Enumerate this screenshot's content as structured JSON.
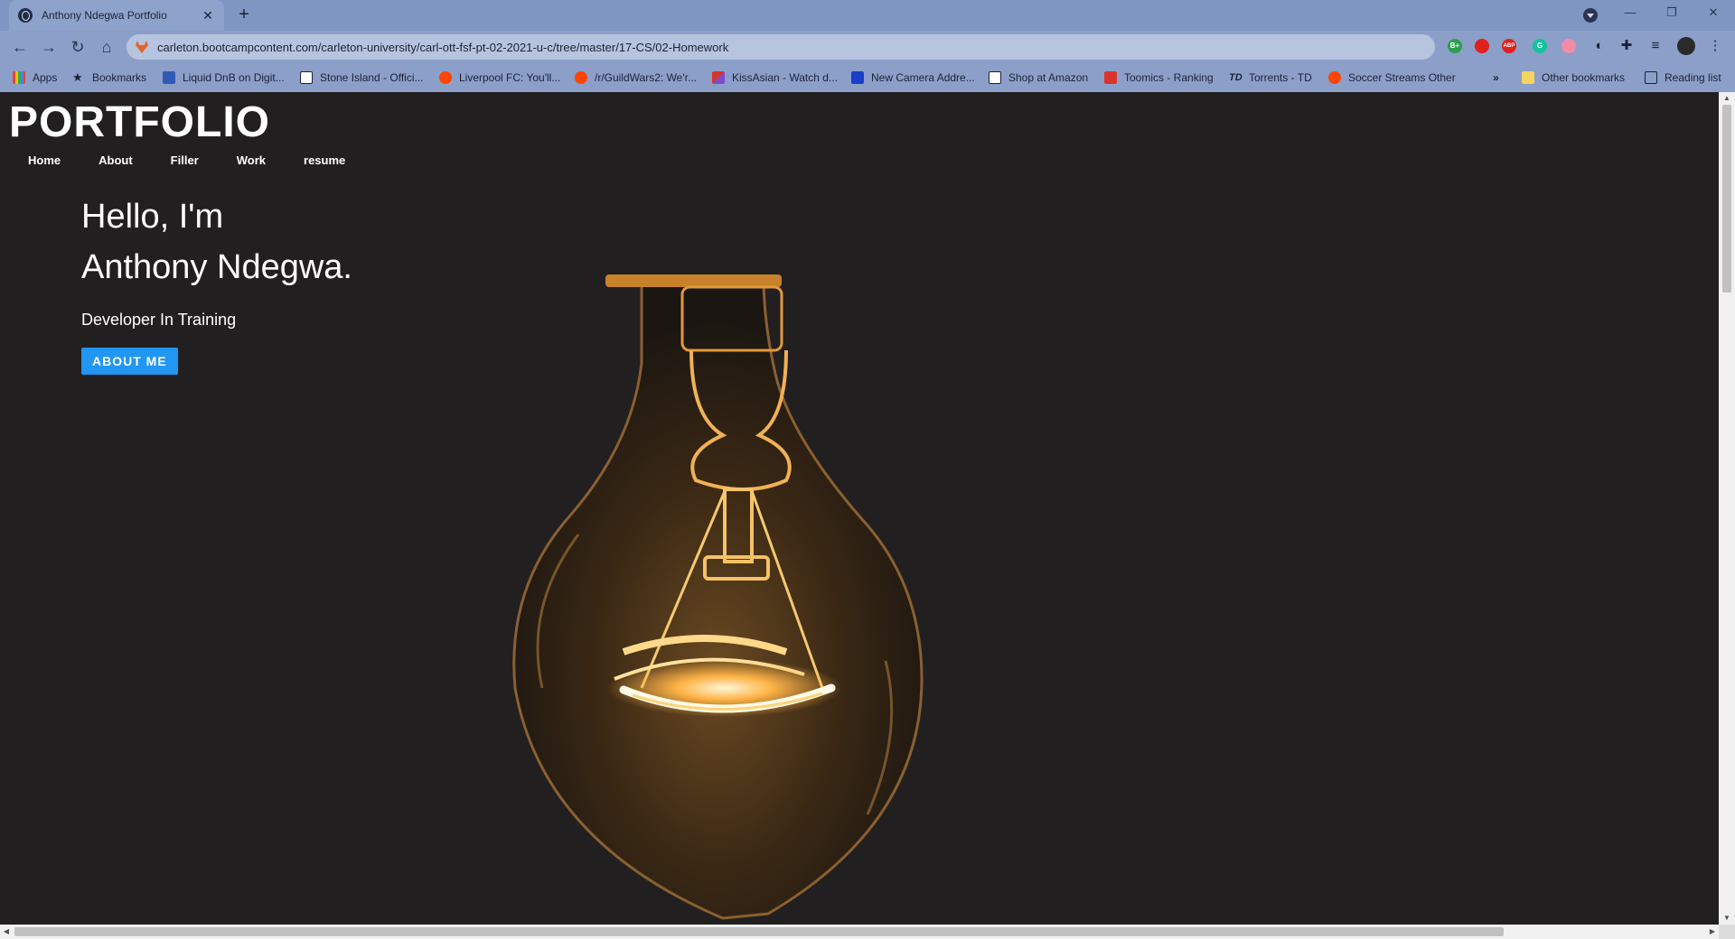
{
  "browser": {
    "tab_title": "Anthony Ndegwa Portfolio",
    "tab_close": "✕",
    "new_tab": "+",
    "url": "carleton.bootcampcontent.com/carleton-university/carl-ott-fsf-pt-02-2021-u-c/tree/master/17-CS/02-Homework",
    "back": "←",
    "forward": "→",
    "reload": "↻",
    "home": "⌂",
    "minimize": "—",
    "restore": "❐",
    "close": "✕",
    "bookmarks": [
      {
        "label": "Apps",
        "color": "#e94235"
      },
      {
        "label": "Bookmarks",
        "color": "#1d2233"
      },
      {
        "label": "Liquid DnB on Digit...",
        "color": "#2f5bb7"
      },
      {
        "label": "Stone Island - Offici...",
        "color": "#ffffff"
      },
      {
        "label": "Liverpool FC: You'll...",
        "color": "#ff4500"
      },
      {
        "label": "/r/GuildWars2: We'r...",
        "color": "#ff4500"
      },
      {
        "label": "KissAsian - Watch d...",
        "color": "#d9342b"
      },
      {
        "label": "New Camera Addre...",
        "color": "#1a3ec9"
      },
      {
        "label": "Shop at Amazon",
        "color": "#ffffff"
      },
      {
        "label": "Toomics - Ranking",
        "color": "#d9342b"
      },
      {
        "label": "Torrents - TD",
        "color": "#1d2233"
      },
      {
        "label": "Soccer Streams Other",
        "color": "#ff4500"
      }
    ],
    "bookmarks_overflow": "»",
    "other_bookmarks": "Other bookmarks",
    "reading_list": "Reading list",
    "extensions": [
      {
        "label": "B+",
        "color": "#2e9e4f"
      },
      {
        "label": "",
        "color": "#e0201b"
      },
      {
        "label": "ABP",
        "color": "#e0201b"
      },
      {
        "label": "G",
        "color": "#15c39a"
      },
      {
        "label": "",
        "color": "#f28ca6"
      }
    ]
  },
  "page": {
    "brand": "PORTFOLIO",
    "nav": [
      "Home",
      "About",
      "Filler",
      "Work",
      "resume"
    ],
    "hero": {
      "line1": "Hello, I'm",
      "line2": "Anthony Ndegwa.",
      "subtitle": "Developer In Training",
      "button": "ABOUT ME"
    }
  },
  "colors": {
    "background": "#221f20",
    "accent": "#2196f3",
    "glow": "#ffb347"
  },
  "scrollbar": {
    "up": "▲",
    "down": "▼",
    "left": "◀",
    "right": "▶"
  }
}
